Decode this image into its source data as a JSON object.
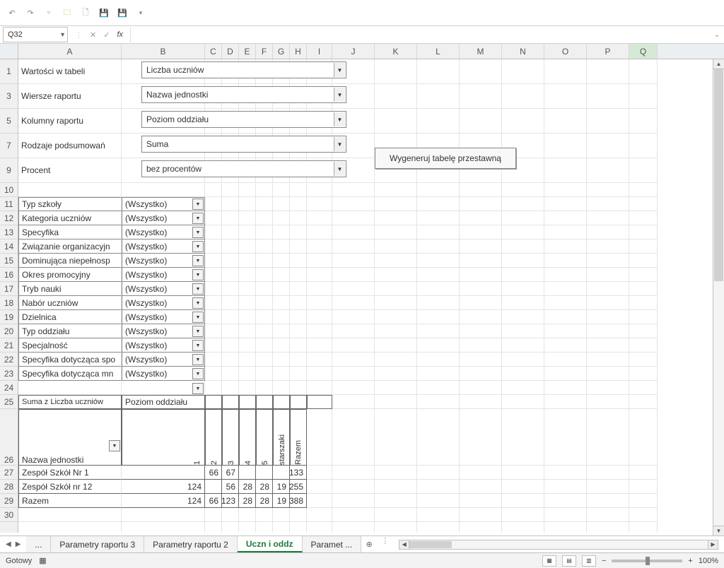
{
  "namebox": "Q32",
  "qat_icons": [
    "undo",
    "redo",
    "new",
    "open",
    "print-preview",
    "save",
    "save-as",
    "more"
  ],
  "columns": [
    "A",
    "B",
    "C",
    "D",
    "E",
    "F",
    "G",
    "H",
    "I",
    "J",
    "K",
    "L",
    "M",
    "N",
    "O",
    "P",
    "Q"
  ],
  "row_numbers": [
    "1",
    "",
    "3",
    "",
    "5",
    "",
    "7",
    "",
    "9",
    "10",
    "11",
    "12",
    "13",
    "14",
    "15",
    "16",
    "17",
    "18",
    "19",
    "20",
    "21",
    "22",
    "23",
    "24",
    "25",
    "26",
    "27",
    "28",
    "29",
    "30",
    ""
  ],
  "labels": {
    "r1": "Wartości w tabeli",
    "r3": "Wiersze raportu",
    "r5": "Kolumny raportu",
    "r7": "Rodzaje podsumowań",
    "r9": "Procent"
  },
  "combos": {
    "c1": "Liczba uczniów",
    "c3": "Nazwa jednostki",
    "c5": "Poziom oddziału",
    "c7": "Suma",
    "c9": "bez procentów"
  },
  "button": "Wygeneruj tabelę przestawną",
  "filters": [
    {
      "label": "Typ szkoły",
      "val": "(Wszystko)"
    },
    {
      "label": "Kategoria uczniów",
      "val": "(Wszystko)"
    },
    {
      "label": "Specyfika",
      "val": "(Wszystko)"
    },
    {
      "label": "Związanie organizacyjn",
      "val": "(Wszystko)"
    },
    {
      "label": "Dominująca niepełnosp",
      "val": "(Wszystko)"
    },
    {
      "label": "Okres promocyjny",
      "val": "(Wszystko)"
    },
    {
      "label": "Tryb nauki",
      "val": "(Wszystko)"
    },
    {
      "label": "Nabór uczniów",
      "val": "(Wszystko)"
    },
    {
      "label": "Dzielnica",
      "val": "(Wszystko)"
    },
    {
      "label": "Typ oddziału",
      "val": "(Wszystko)"
    },
    {
      "label": "Specjalność",
      "val": "(Wszystko)"
    },
    {
      "label": "Specyfika dotycząca spo",
      "val": "(Wszystko)"
    },
    {
      "label": "Specyfika dotycząca mn",
      "val": "(Wszystko)"
    }
  ],
  "pivot": {
    "row25_a": "Suma z Liczba uczniów",
    "row25_b": "Poziom oddziału",
    "row26_a": "Nazwa jednostki",
    "cols": [
      "1",
      "2",
      "3",
      "4",
      "5",
      "starszaki",
      "Razem"
    ],
    "rows": [
      {
        "name": "Zespół Szkół Nr 1",
        "v": [
          "",
          "66",
          "67",
          "",
          "",
          "",
          "133"
        ]
      },
      {
        "name": "Zespół Szkół nr 12",
        "v": [
          "124",
          "",
          "56",
          "28",
          "28",
          "19",
          "255"
        ]
      },
      {
        "name": "Razem",
        "v": [
          "124",
          "66",
          "123",
          "28",
          "28",
          "19",
          "388"
        ]
      }
    ]
  },
  "tabs": {
    "ellipsis": "...",
    "t1": "Parametry raportu 3",
    "t2": "Parametry raportu 2",
    "active": "Uczn i oddz",
    "t4": "Paramet"
  },
  "status": {
    "ready": "Gotowy",
    "zoom": "100%"
  }
}
